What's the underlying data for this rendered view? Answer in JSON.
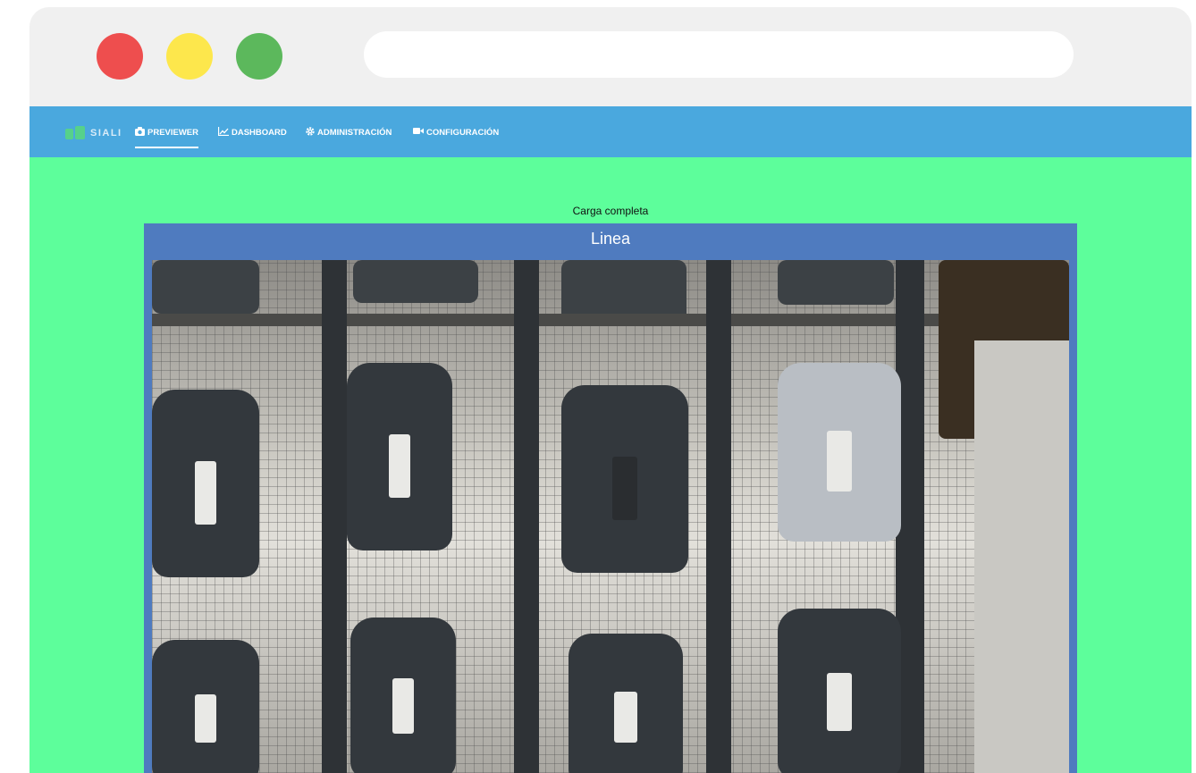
{
  "window": {
    "controls": [
      "close",
      "minimize",
      "maximize"
    ],
    "address_bar": ""
  },
  "navbar": {
    "brand": "SIALI",
    "items": [
      {
        "label": "PREVIEWER",
        "icon": "camera-icon",
        "active": true
      },
      {
        "label": "DASHBOARD",
        "icon": "chart-line-icon",
        "active": false
      },
      {
        "label": "ADMINISTRACIÓN",
        "icon": "gear-icon",
        "active": false
      },
      {
        "label": "CONFIGURACIÓN",
        "icon": "video-camera-icon",
        "active": false
      }
    ]
  },
  "main": {
    "status": "Carga completa",
    "panel_title": "Linea",
    "image": "camera-feed-brake-calipers"
  },
  "colors": {
    "navbar": "#4aa8de",
    "page_background": "#5dfe9b",
    "panel": "#4f7bbf"
  }
}
